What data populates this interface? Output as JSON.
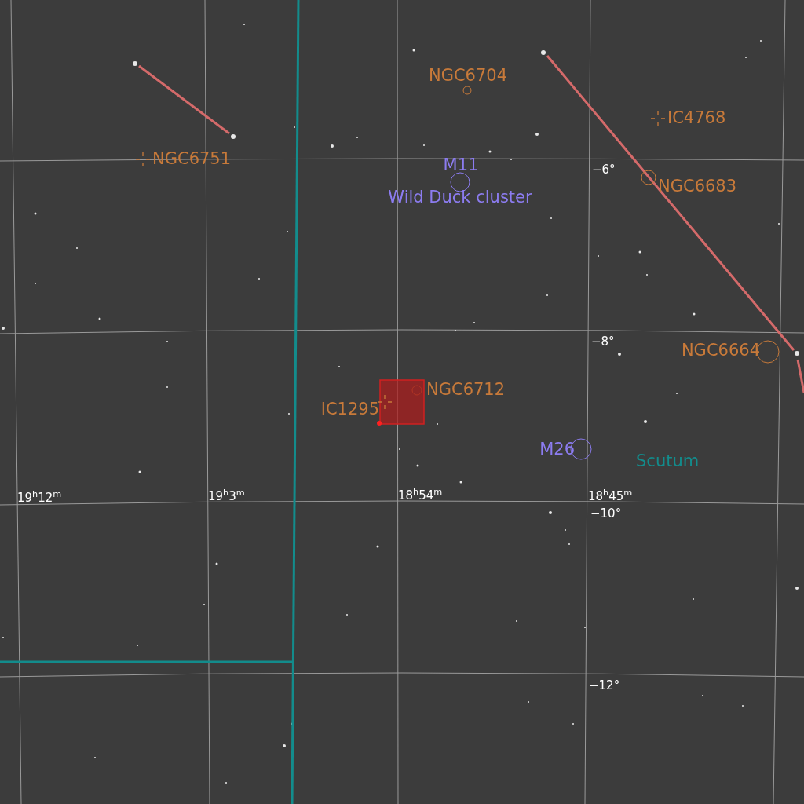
{
  "sky_chart": {
    "ra_labels": [
      "19$^{h}$12$^{m}$",
      "19$^{h}$3$^{m}$",
      "18$^{h}$54$^{m}$",
      "18$^{h}$45$^{m}$"
    ],
    "dec_labels": [
      "−6°",
      "−8°",
      "−10°",
      "−12°"
    ],
    "constellation": "Scutum",
    "objects": [
      {
        "label": "NGC6704",
        "kind": "circle",
        "color": "#c87a3a",
        "selected": false
      },
      {
        "label": "IC4768",
        "kind": "cross",
        "color": "#c87a3a",
        "selected": false
      },
      {
        "label": "NGC6751",
        "kind": "cross",
        "color": "#c87a3a",
        "selected": false
      },
      {
        "label": "M11",
        "common_name": "Wild Duck cluster",
        "kind": "circle",
        "color": "#8c7cf0",
        "selected": false
      },
      {
        "label": "NGC6683",
        "kind": "circle",
        "color": "#c87a3a",
        "selected": false
      },
      {
        "label": "NGC6664",
        "kind": "circle",
        "color": "#c87a3a",
        "selected": false
      },
      {
        "label": "NGC6712",
        "kind": "circle",
        "color": "#c87a3a",
        "selected": false
      },
      {
        "label": "IC1295",
        "kind": "cross",
        "color": "#c87a3a",
        "selected": true
      },
      {
        "label": "M26",
        "kind": "circle",
        "color": "#8c7cf0",
        "selected": false
      }
    ]
  }
}
